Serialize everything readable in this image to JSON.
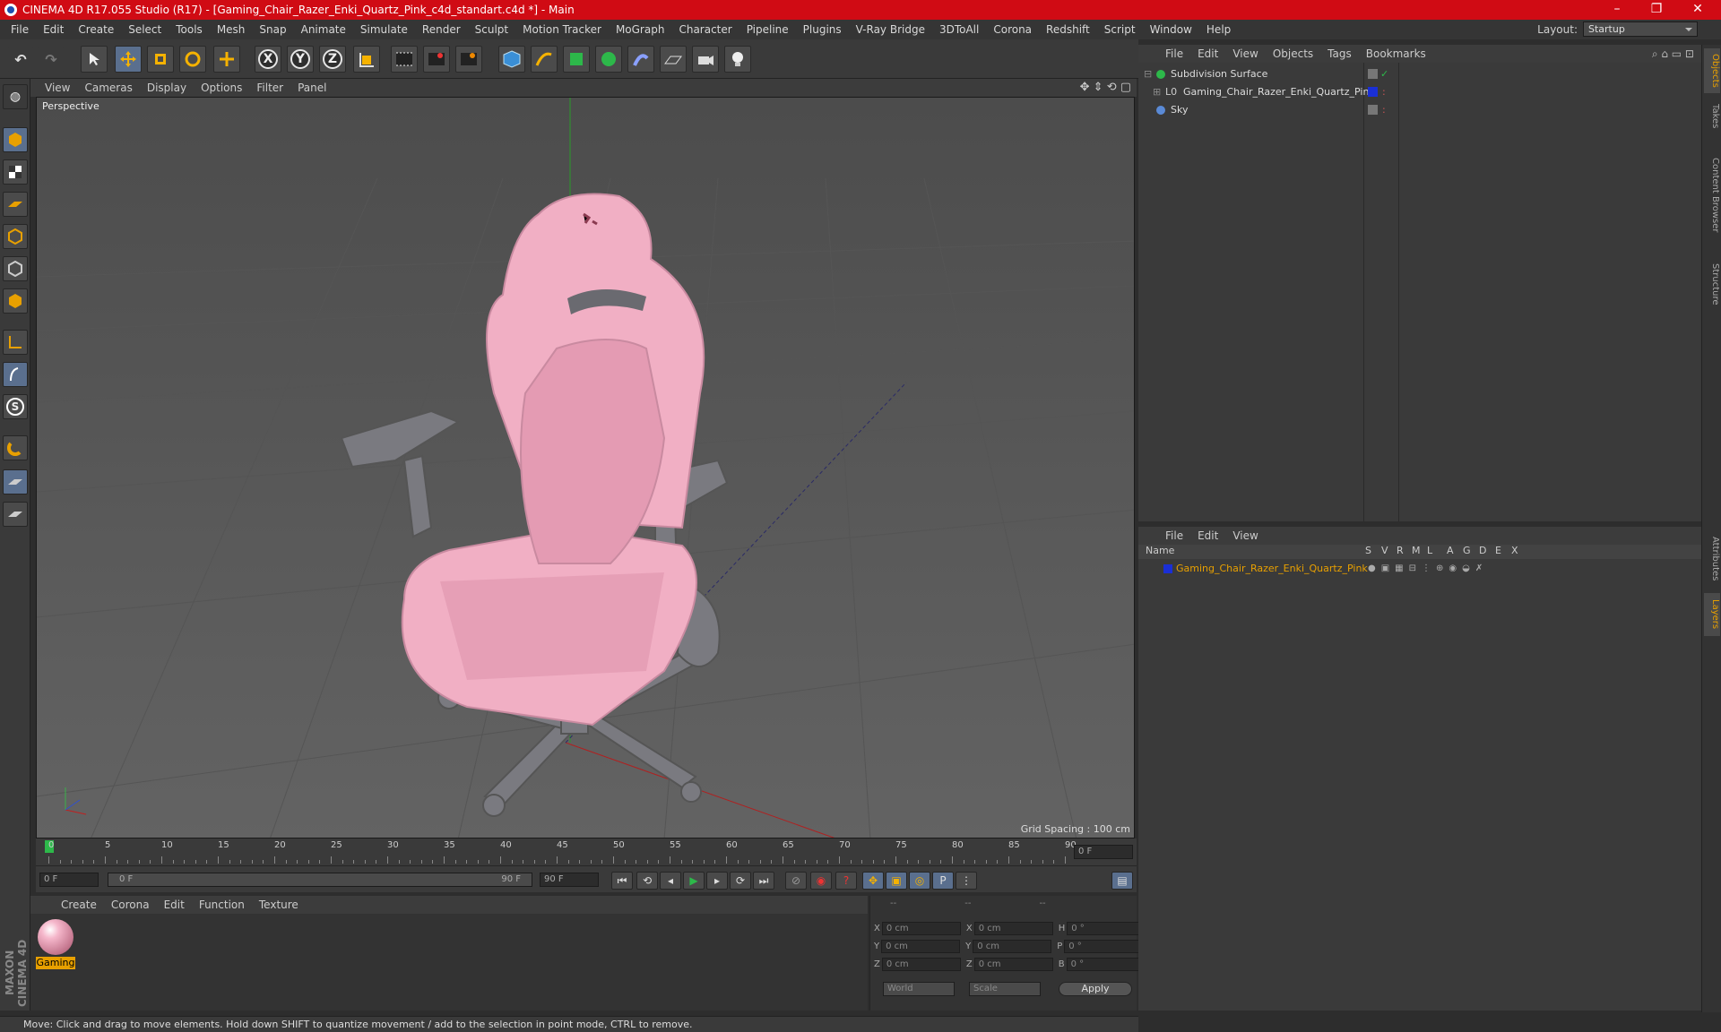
{
  "window": {
    "title": "CINEMA 4D R17.055 Studio (R17) - [Gaming_Chair_Razer_Enki_Quartz_Pink_c4d_standart.c4d *] - Main",
    "minimize": "–",
    "maximize": "❐",
    "close": "✕"
  },
  "menu": [
    "File",
    "Edit",
    "Create",
    "Select",
    "Tools",
    "Mesh",
    "Snap",
    "Animate",
    "Simulate",
    "Render",
    "Sculpt",
    "Motion Tracker",
    "MoGraph",
    "Character",
    "Pipeline",
    "Plugins",
    "V-Ray Bridge",
    "3DToAll",
    "Corona",
    "Redshift",
    "Script",
    "Window",
    "Help"
  ],
  "layout": {
    "label": "Layout:",
    "value": "Startup"
  },
  "toolbar": {
    "x": "X",
    "y": "Y",
    "z": "Z"
  },
  "viewport": {
    "menu": [
      "View",
      "Cameras",
      "Display",
      "Options",
      "Filter",
      "Panel"
    ],
    "label": "Perspective",
    "grid_spacing": "Grid Spacing : 100 cm"
  },
  "timeline": {
    "ticks": [
      "0",
      "5",
      "10",
      "15",
      "20",
      "25",
      "30",
      "35",
      "40",
      "45",
      "50",
      "55",
      "60",
      "65",
      "70",
      "75",
      "80",
      "85",
      "90"
    ],
    "current_frame": "0 F",
    "start": "0 F",
    "range_start": "0 F",
    "range_end": "90 F",
    "end": "90 F"
  },
  "material_panel": {
    "menu": [
      "Create",
      "Corona",
      "Edit",
      "Function",
      "Texture"
    ],
    "material_name": "Gaming"
  },
  "coords": {
    "headers": [
      "--",
      "--",
      "--"
    ],
    "rows": [
      {
        "a": "X",
        "v1": "0 cm",
        "b": "X",
        "v2": "0 cm",
        "c": "H",
        "v3": "0 °"
      },
      {
        "a": "Y",
        "v1": "0 cm",
        "b": "Y",
        "v2": "0 cm",
        "c": "P",
        "v3": "0 °"
      },
      {
        "a": "Z",
        "v1": "0 cm",
        "b": "Z",
        "v2": "0 cm",
        "c": "B",
        "v3": "0 °"
      }
    ],
    "mode1": "World",
    "mode2": "Scale",
    "apply": "Apply"
  },
  "status": "Move: Click and drag to move elements. Hold down SHIFT to quantize movement / add to the selection in point mode, CTRL to remove.",
  "objects_panel": {
    "menu": [
      "File",
      "Edit",
      "View",
      "Objects",
      "Tags",
      "Bookmarks"
    ],
    "items": [
      {
        "name": "Subdivision Surface"
      },
      {
        "name": "Gaming_Chair_Razer_Enki_Quartz_Pink"
      },
      {
        "name": "Sky"
      }
    ]
  },
  "layers_panel": {
    "menu": [
      "File",
      "Edit",
      "View"
    ],
    "columns": [
      "Name",
      "S",
      "V",
      "R",
      "M",
      "L",
      "A",
      "G",
      "D",
      "E",
      "X"
    ],
    "items": [
      {
        "name": "Gaming_Chair_Razer_Enki_Quartz_Pink"
      }
    ]
  },
  "side_tabs": [
    "Objects",
    "Takes",
    "Content Browser",
    "Structure",
    "Attributes",
    "Layers"
  ],
  "brand": "MAXON CINEMA 4D",
  "colors": {
    "accent": "#d00b14",
    "selection": "#e8a000",
    "layer": "#1a2fd6"
  }
}
